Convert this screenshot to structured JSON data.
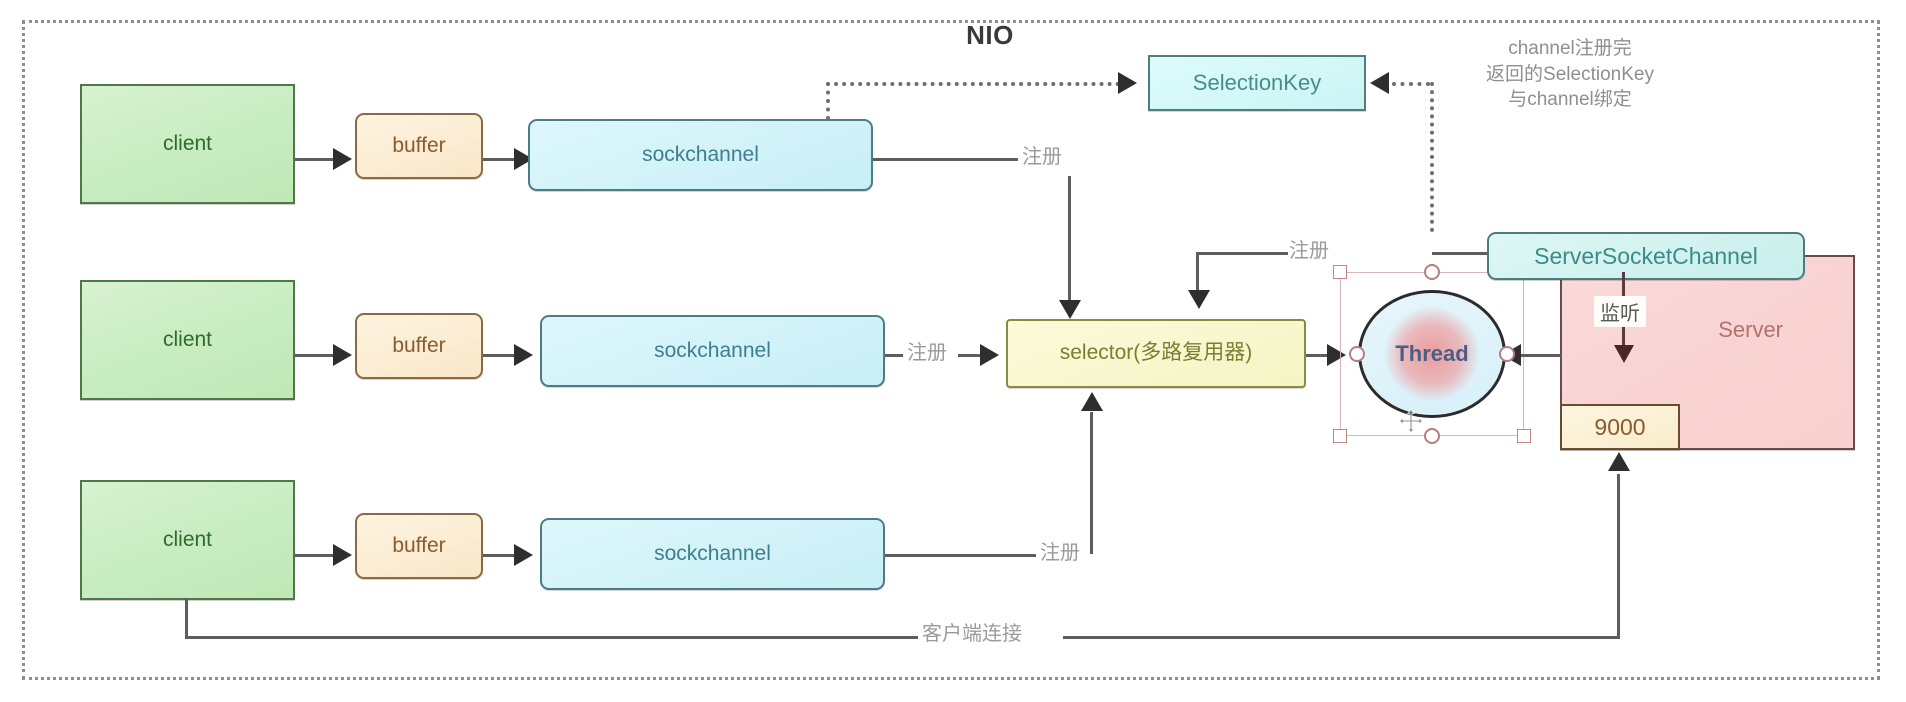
{
  "diagram": {
    "title": "NIO",
    "rows": [
      {
        "client": "client",
        "buffer": "buffer",
        "channel": "sockchannel",
        "register_label": "注册"
      },
      {
        "client": "client",
        "buffer": "buffer",
        "channel": "sockchannel",
        "register_label": "注册"
      },
      {
        "client": "client",
        "buffer": "buffer",
        "channel": "sockchannel",
        "register_label": "注册"
      }
    ],
    "selection_key": {
      "label": "SelectionKey"
    },
    "selector": {
      "label": "selector(多路复用器)"
    },
    "thread": {
      "label": "Thread"
    },
    "server_socket_channel": {
      "label": "ServerSocketChannel",
      "register_label": "注册"
    },
    "server": {
      "label": "Server",
      "listen_label": "监听",
      "port": "9000"
    },
    "client_connection_label": "客户端连接",
    "note": "channel注册完\n返回的SelectionKey\n与channel绑定",
    "colors": {
      "client_fill": "#cdefc6",
      "client_stroke": "#4b7a45",
      "buffer_fill": "#fbecd2",
      "buffer_stroke": "#8a6a44",
      "channel_fill": "#d4f3f9",
      "channel_stroke": "#4d7d84",
      "selector_fill": "#f7f7cd",
      "selector_stroke": "#8a8a40",
      "server_fill": "#f9d3d3",
      "server_stroke": "#6b4a4a",
      "port_fill": "#faf0d4",
      "thread_accent": "#ef8484",
      "frame_stroke": "#8e8e8e",
      "line_stroke": "#5d5d5d"
    }
  }
}
